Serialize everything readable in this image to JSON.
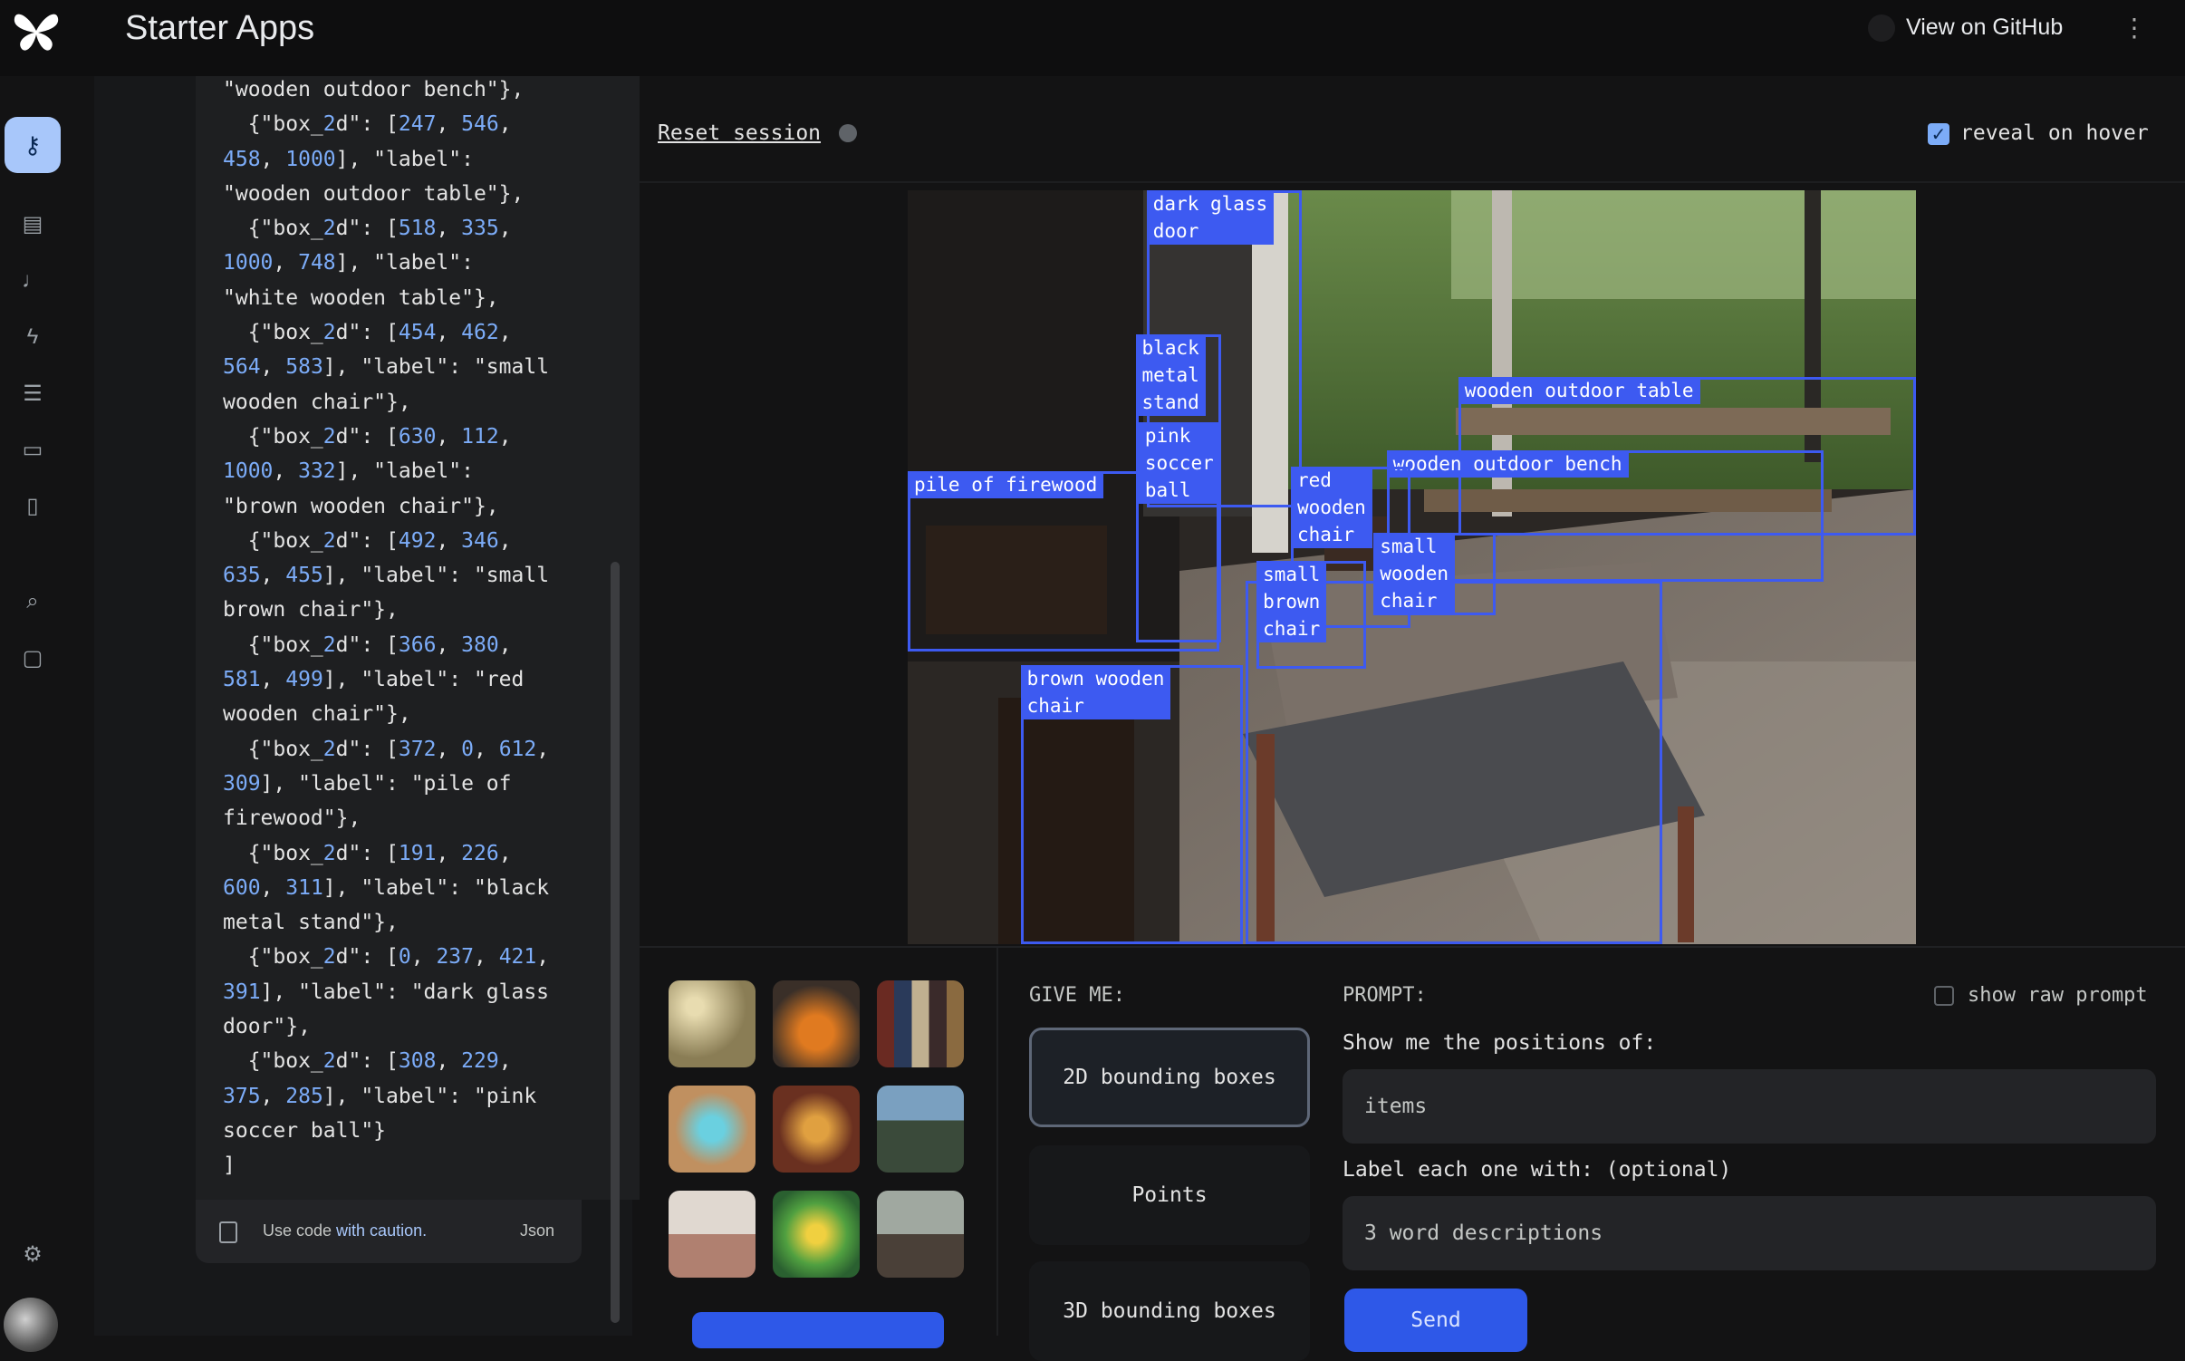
{
  "app": {
    "title": "Starter Apps",
    "github_label": "View on GitHub"
  },
  "rail": {
    "icons": [
      "key-icon",
      "chat-icon",
      "mic-icon",
      "bolt-icon",
      "tune-icon",
      "archive-icon",
      "book-icon",
      "search-document-icon",
      "forum-icon",
      "gear-icon"
    ]
  },
  "code": {
    "lines": [
      "\"wooden outdoor bench\"},",
      "  {\"box_2d\": [247, 546,",
      "458, 1000], \"label\":",
      "\"wooden outdoor table\"},",
      "  {\"box_2d\": [518, 335,",
      "1000, 748], \"label\":",
      "\"white wooden table\"},",
      "  {\"box_2d\": [454, 462,",
      "564, 583], \"label\": \"small",
      "wooden chair\"},",
      "  {\"box_2d\": [630, 112,",
      "1000, 332], \"label\":",
      "\"brown wooden chair\"},",
      "  {\"box_2d\": [492, 346,",
      "635, 455], \"label\": \"small",
      "brown chair\"},",
      "  {\"box_2d\": [366, 380,",
      "581, 499], \"label\": \"red",
      "wooden chair\"},",
      "  {\"box_2d\": [372, 0, 612,",
      "309], \"label\": \"pile of",
      "firewood\"},",
      "  {\"box_2d\": [191, 226,",
      "600, 311], \"label\": \"black",
      "metal stand\"},",
      "  {\"box_2d\": [0, 237, 421,",
      "391], \"label\": \"dark glass",
      "door\"},",
      "  {\"box_2d\": [308, 229,",
      "375, 285], \"label\": \"pink",
      "soccer ball\"}",
      "]"
    ],
    "footer_prefix": "Use code ",
    "footer_link": "with caution.",
    "language": "Json"
  },
  "toolbar": {
    "reset_label": "Reset session",
    "reveal_label": "reveal on hover",
    "reveal_checked": true
  },
  "detections": [
    {
      "label": "dark glass\ndoor",
      "box_2d": [
        0,
        237,
        421,
        391
      ]
    },
    {
      "label": "black\nmetal\nstand",
      "box_2d": [
        191,
        226,
        600,
        311
      ]
    },
    {
      "label": "pink\nsoccer\nball",
      "box_2d": [
        308,
        229,
        375,
        285
      ]
    },
    {
      "label": "wooden outdoor table",
      "box_2d": [
        247,
        546,
        458,
        1000
      ]
    },
    {
      "label": "wooden outdoor bench",
      "box_2d": [
        345,
        475,
        519,
        908
      ]
    },
    {
      "label": "pile of firewood",
      "box_2d": [
        372,
        0,
        612,
        309
      ]
    },
    {
      "label": "red\nwooden\nchair",
      "box_2d": [
        366,
        380,
        581,
        499
      ]
    },
    {
      "label": "small\nwooden\nchair",
      "box_2d": [
        454,
        462,
        564,
        583
      ]
    },
    {
      "label": "small\nbrown\nchair",
      "box_2d": [
        492,
        346,
        635,
        455
      ]
    },
    {
      "label": "brown wooden\nchair",
      "box_2d": [
        630,
        112,
        1000,
        332
      ]
    },
    {
      "label": "",
      "box_2d": [
        518,
        335,
        1000,
        748
      ]
    }
  ],
  "thumbnails": [
    "candies-thumbnail",
    "pumpkins-thumbnail",
    "books-thumbnail",
    "origami-thumbnail",
    "food-thumbnail",
    "city-thumbnail",
    "desk-thumbnail",
    "cake-thumbnail",
    "porch-thumbnail"
  ],
  "give_me": {
    "heading": "GIVE ME:",
    "options": [
      "2D bounding boxes",
      "Points",
      "3D bounding boxes"
    ],
    "selected": "2D bounding boxes"
  },
  "prompt": {
    "heading": "PROMPT:",
    "show_raw_label": "show raw prompt",
    "positions_label": "Show me the positions of:",
    "items_value": "items",
    "label_with": "Label each one with: (optional)",
    "descriptions_value": "3 word descriptions",
    "send_label": "Send"
  },
  "colors": {
    "accent": "#3d5af1",
    "rail_active": "#a8c7fa",
    "number": "#7cacf8"
  }
}
